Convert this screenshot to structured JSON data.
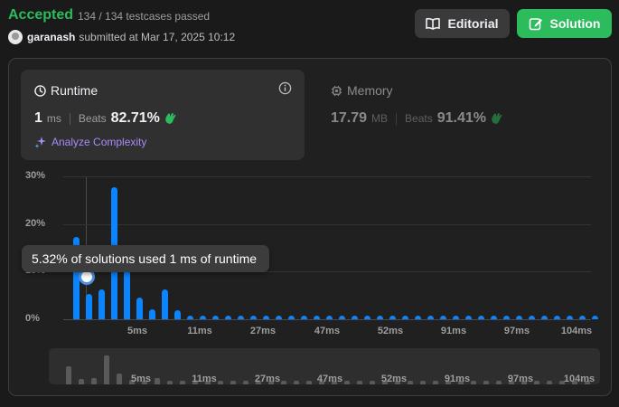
{
  "status": {
    "label": "Accepted",
    "testcases": "134 / 134 testcases passed"
  },
  "submission": {
    "user": "garanash",
    "submitted": "submitted at Mar 17, 2025 10:12"
  },
  "buttons": {
    "editorial": "Editorial",
    "solution": "Solution"
  },
  "runtime": {
    "title": "Runtime",
    "value": "1",
    "unit": "ms",
    "beats_label": "Beats",
    "beats_pct": "82.71%",
    "analyze_label": "Analyze Complexity"
  },
  "memory": {
    "title": "Memory",
    "value": "17.79",
    "unit": "MB",
    "beats_label": "Beats",
    "beats_pct": "91.41%"
  },
  "tooltip": "5.32% of solutions used 1 ms of runtime",
  "colors": {
    "accent_green": "#2cbb5d",
    "bar_blue": "#0a84ff",
    "analyze_purple": "#a78bfa"
  },
  "chart_data": {
    "type": "bar",
    "y_ticks": [
      "30%",
      "20%",
      "10%",
      "0%"
    ],
    "ylim": [
      0,
      30
    ],
    "x_tick_labels": [
      "5ms",
      "11ms",
      "27ms",
      "47ms",
      "52ms",
      "91ms",
      "97ms",
      "104ms"
    ],
    "values": [
      17.3,
      5.3,
      6.2,
      27.8,
      10.2,
      4.5,
      2.0,
      6.3,
      1.9,
      0.7,
      0.7,
      0.7,
      0.7,
      0.7,
      0.7,
      0.7,
      0.7,
      0.7,
      0.7,
      0.7,
      0.7,
      0.7,
      0.7,
      0.7,
      0.7,
      0.7,
      0.7,
      0.7,
      0.7,
      0.7,
      0.7,
      0.7,
      0.7,
      0.7,
      0.7,
      0.7,
      0.7,
      0.7,
      0.7,
      0.7,
      0.7,
      0.7
    ],
    "highlighted_index": 1,
    "highlighted_value": 5.32
  }
}
